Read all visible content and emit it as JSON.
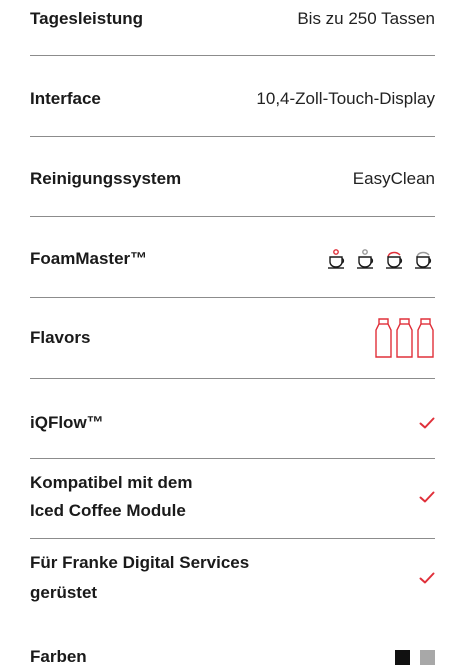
{
  "specs": {
    "daily_output": {
      "label": "Tagesleistung",
      "value": "Bis zu 250 Tassen"
    },
    "interface": {
      "label": "Interface",
      "value": "10,4-Zoll-Touch-Display"
    },
    "cleaning": {
      "label": "Reinigungssystem",
      "value": "EasyClean"
    },
    "foammaster": {
      "label": "FoamMaster™",
      "icons": [
        "hot-foam-cup-icon",
        "hot-milk-cup-icon",
        "cold-foam-cup-icon",
        "cold-milk-cup-icon"
      ]
    },
    "flavors": {
      "label": "Flavors",
      "icons": [
        "flavor-bottle-icon",
        "flavor-bottle-icon",
        "flavor-bottle-icon"
      ]
    },
    "iqflow": {
      "label": "iQFlow™",
      "icon": "check-icon"
    },
    "iced_coffee": {
      "label_line1": "Kompatibel mit dem",
      "label_line2": "Iced Coffee Module",
      "icon": "check-icon"
    },
    "digital_services": {
      "label_line1": "Für Franke Digital Services",
      "label_line2": "gerüstet",
      "icon": "check-icon"
    },
    "colors": {
      "label": "Farben",
      "swatches": [
        "#111111",
        "#a8a8a8"
      ]
    }
  },
  "colors": {
    "accent": "#e0303a",
    "divider": "#8c8c8c",
    "text": "#1a1a1a"
  }
}
